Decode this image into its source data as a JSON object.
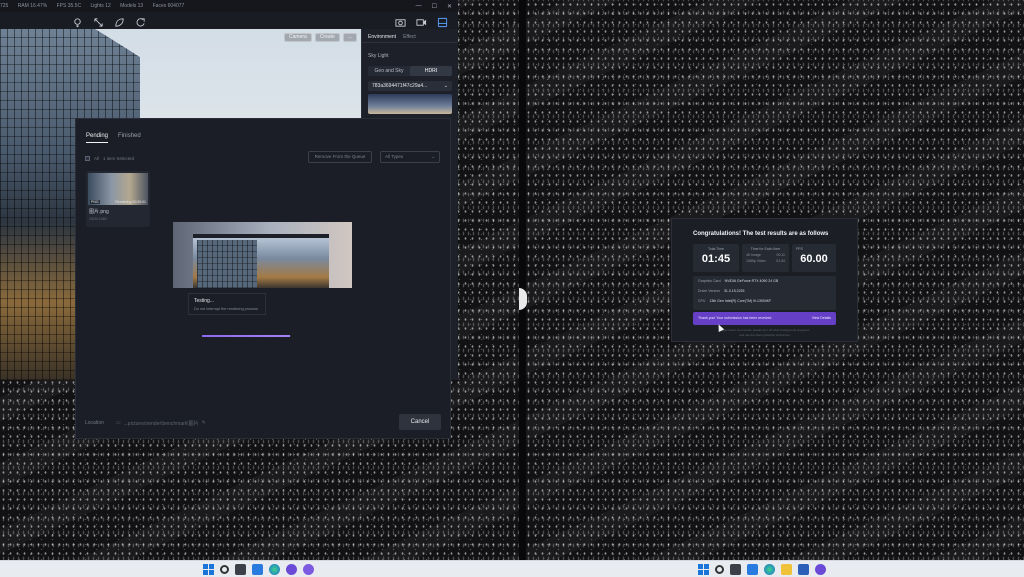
{
  "app": {
    "stats": [
      "725",
      "RAM 16.47%",
      "FPS 35.5C",
      "Lights 12",
      "Models 13",
      "Faces 604077"
    ],
    "viewport_buttons": [
      "Camera",
      "Create",
      "..."
    ],
    "right_panel": {
      "tabs": [
        "Environment",
        "Effect"
      ],
      "section": "Sky Light",
      "modes": [
        "Geo and Sky",
        "HDRI"
      ],
      "hdri_value": "783a3694471f47c29a4..."
    }
  },
  "queue": {
    "tabs": [
      "Pending",
      "Finished"
    ],
    "select_all": "All",
    "selected_count": "1 item Selected",
    "remove_button": "Remove From the Queue",
    "type_filter": "All Types",
    "card": {
      "tag": "PNG",
      "status": "Rendering 00:00:01",
      "name": "图片.png",
      "meta": "1920×1080"
    },
    "testing_title": "Testing...",
    "testing_sub": "Do not interrupt the rendering process",
    "progress": 0.99,
    "location_label": "Location",
    "location_path": "...pictures\\render\\benchmark\\图片",
    "cancel_button": "Cancel"
  },
  "results": {
    "title": "Congratulations! The test results are as follows",
    "total_time_label": "Total Time",
    "total_time": "01:45",
    "each_item_label": "Time for Each Item",
    "each_rows": [
      {
        "label": "4K Image",
        "value": "00:11"
      },
      {
        "label": "1080p Video",
        "value": "01:34"
      }
    ],
    "fps_label": "FPS",
    "fps": "60.00",
    "gpu_label": "Graphics Card",
    "gpu": "NVIDIA GeForce RTX 4090 24 GB",
    "version_label": "Driver Version",
    "version": "31.0.15.2225",
    "cpu_label": "CPU",
    "cpu": "13th Gen Intel(R) Core(TM) i9-13900KF",
    "banner_text": "Thank you! Your submission has been received",
    "details_link": "View Details",
    "note_line1": "To get better test results, please turn off other background programs",
    "note_line2": "and use the latest graphics card driver"
  },
  "icons": {
    "toolbar": [
      "light-icon",
      "measure-icon",
      "leaf-icon",
      "refresh-icon",
      "camera-icon",
      "video-icon",
      "layers-icon"
    ],
    "taskbar_left": [
      "windows-start-icon",
      "search-icon",
      "task-view-icon",
      "widgets-icon",
      "edge-icon",
      "app-icon",
      "app-icon"
    ],
    "taskbar_right": [
      "windows-start-icon",
      "search-icon",
      "task-view-icon",
      "widgets-icon",
      "edge-icon",
      "files-icon",
      "store-icon",
      "app-icon",
      "app-icon"
    ]
  }
}
